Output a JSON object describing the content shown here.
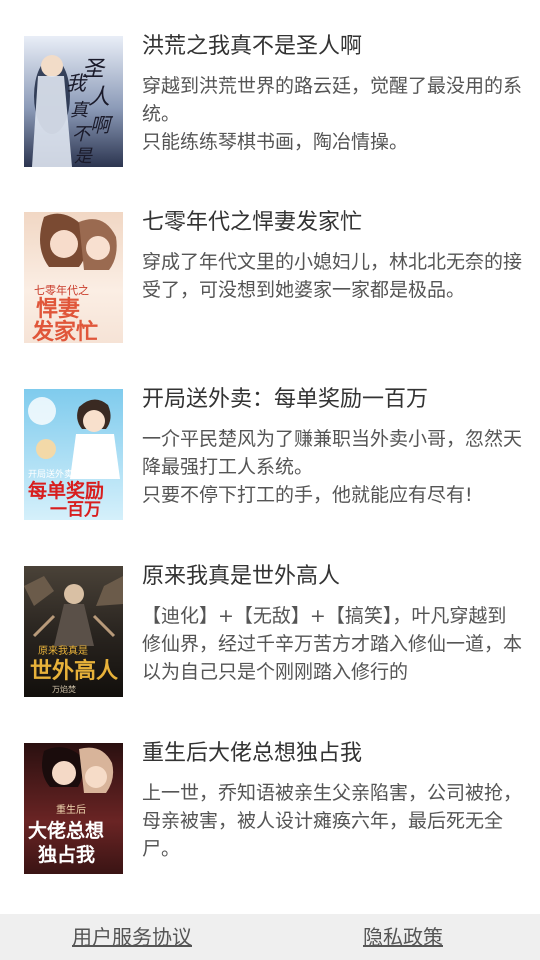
{
  "books": [
    {
      "title": "洪荒之我真不是圣人啊",
      "description": "穿越到洪荒世界的路云廷，觉醒了最没用的系统。\n只能练练琴棋书画，陶冶情操。",
      "cover_text": "我真不是圣人啊",
      "cover_colors": [
        "#3a4a6a",
        "#cfd6e6"
      ]
    },
    {
      "title": "七零年代之悍妻发家忙",
      "description": "穿成了年代文里的小媳妇儿，林北北无奈的接受了，可没想到她婆家一家都是极品。",
      "cover_text": "悍妻发家忙",
      "cover_colors": [
        "#f6e1d2",
        "#e0563a"
      ]
    },
    {
      "title": "开局送外卖：每单奖励一百万",
      "description": "一介平民楚风为了赚兼职当外卖小哥，忽然天降最强打工人系统。\n只要不停下打工的手，他就能应有尽有!",
      "cover_text": "每单奖励一百万",
      "cover_colors": [
        "#8fd3ef",
        "#d81e1e"
      ]
    },
    {
      "title": "原来我真是世外高人",
      "description": "【迪化】+【无敌】+【搞笑】，叶凡穿越到修仙界，经过千辛万苦方才踏入修仙一道，本以为自己只是个刚刚踏入修行的",
      "cover_text": "世外高人",
      "cover_colors": [
        "#1c1a18",
        "#e8b23a"
      ]
    },
    {
      "title": "重生后大佬总想独占我",
      "description": "上一世，乔知语被亲生父亲陷害，公司被抢，母亲被害，被人设计瘫痪六年，最后死无全尸。",
      "cover_text": "大佬总想独占我",
      "cover_colors": [
        "#5a1d1d",
        "#f0d7b0"
      ]
    }
  ],
  "footer": {
    "user_agreement": "用户服务协议",
    "privacy_policy": "隐私政策"
  }
}
